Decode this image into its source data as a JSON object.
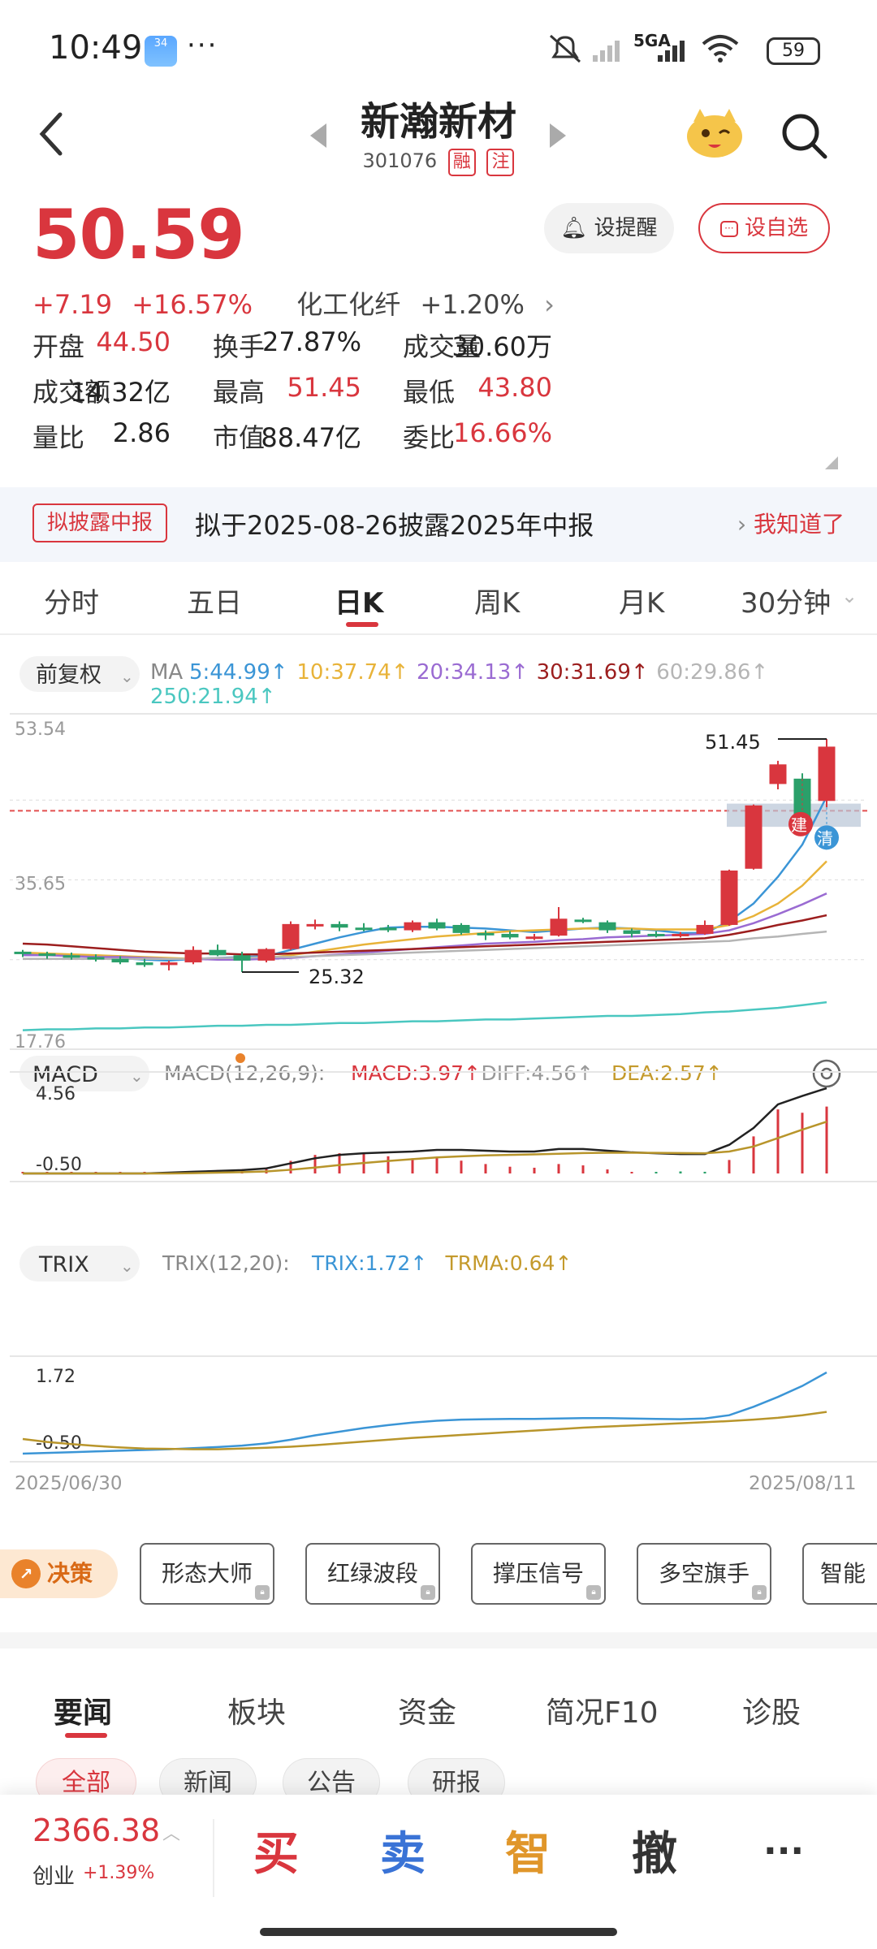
{
  "status_bar": {
    "time": "10:49",
    "weather_badge": "34",
    "network": "5GA",
    "battery": "59"
  },
  "header": {
    "stock_name": "新瀚新材",
    "stock_code": "301076",
    "tag_margin": "融",
    "tag_note": "注"
  },
  "quote": {
    "price": "50.59",
    "change": "+7.19",
    "change_pct": "+16.57%",
    "sector": "化工化纤",
    "sector_pct": "+1.20%",
    "alert_button": "设提醒",
    "fav_button": "设自选"
  },
  "stats": [
    {
      "label": "开盘",
      "value": "44.50",
      "color": "red"
    },
    {
      "label": "换手",
      "value": "27.87%",
      "color": "black"
    },
    {
      "label": "成交量",
      "value": "30.60万",
      "color": "black"
    },
    {
      "label": "成交额",
      "value": "14.32亿",
      "color": "black"
    },
    {
      "label": "最高",
      "value": "51.45",
      "color": "red"
    },
    {
      "label": "最低",
      "value": "43.80",
      "color": "red"
    },
    {
      "label": "量比",
      "value": "2.86",
      "color": "black"
    },
    {
      "label": "市值",
      "value": "88.47亿",
      "color": "black"
    },
    {
      "label": "委比",
      "value": "16.66%",
      "color": "red"
    }
  ],
  "banner": {
    "tag": "拟披露中报",
    "text": "拟于2025-08-26披露2025年中报",
    "ack": "我知道了"
  },
  "period_tabs": [
    "分时",
    "五日",
    "日K",
    "周K",
    "月K",
    "30分钟"
  ],
  "selected_tab": "日K",
  "chart_data": [
    {
      "type": "candlestick",
      "adjust": "前复权",
      "ma_legend": [
        {
          "label": "5:44.99",
          "color": "#3b95d6"
        },
        {
          "label": "10:37.74",
          "color": "#e8b339"
        },
        {
          "label": "20:34.13",
          "color": "#9a6bd2"
        },
        {
          "label": "30:31.69",
          "color": "#9c1e1e"
        },
        {
          "label": "60:29.86",
          "color": "#b5b5b5"
        },
        {
          "label": "250:21.94",
          "color": "#4ac7c0"
        }
      ],
      "y_ticks": [
        "53.54",
        "35.65",
        "17.76"
      ],
      "ylim": [
        17.76,
        53.54
      ],
      "high_label": "51.45",
      "low_label": "25.32",
      "markers": [
        "建",
        "清"
      ],
      "candles": [
        {
          "o": 27.6,
          "h": 27.8,
          "l": 27.0,
          "c": 27.4
        },
        {
          "o": 27.4,
          "h": 27.6,
          "l": 26.8,
          "c": 27.2
        },
        {
          "o": 27.2,
          "h": 27.5,
          "l": 26.7,
          "c": 27.0
        },
        {
          "o": 27.0,
          "h": 27.3,
          "l": 26.5,
          "c": 26.9
        },
        {
          "o": 26.8,
          "h": 27.1,
          "l": 26.2,
          "c": 26.4
        },
        {
          "o": 26.4,
          "h": 26.8,
          "l": 25.9,
          "c": 26.1
        },
        {
          "o": 26.1,
          "h": 26.6,
          "l": 25.5,
          "c": 26.4
        },
        {
          "o": 26.4,
          "h": 28.2,
          "l": 26.2,
          "c": 27.8
        },
        {
          "o": 27.8,
          "h": 28.4,
          "l": 27.1,
          "c": 27.2
        },
        {
          "o": 27.2,
          "h": 27.6,
          "l": 25.32,
          "c": 26.6
        },
        {
          "o": 26.6,
          "h": 28.0,
          "l": 26.4,
          "c": 27.9
        },
        {
          "o": 27.9,
          "h": 31.0,
          "l": 27.8,
          "c": 30.7
        },
        {
          "o": 30.6,
          "h": 31.2,
          "l": 30.1,
          "c": 30.7
        },
        {
          "o": 30.7,
          "h": 31.0,
          "l": 29.9,
          "c": 30.3
        },
        {
          "o": 30.3,
          "h": 30.8,
          "l": 29.9,
          "c": 30.2
        },
        {
          "o": 30.3,
          "h": 30.6,
          "l": 29.8,
          "c": 30.0
        },
        {
          "o": 30.0,
          "h": 31.1,
          "l": 29.8,
          "c": 30.9
        },
        {
          "o": 30.9,
          "h": 31.3,
          "l": 30.0,
          "c": 30.2
        },
        {
          "o": 30.6,
          "h": 30.8,
          "l": 29.5,
          "c": 29.7
        },
        {
          "o": 29.7,
          "h": 30.0,
          "l": 28.9,
          "c": 29.6
        },
        {
          "o": 29.6,
          "h": 29.9,
          "l": 29.0,
          "c": 29.2
        },
        {
          "o": 29.2,
          "h": 29.6,
          "l": 28.9,
          "c": 29.3
        },
        {
          "o": 29.4,
          "h": 32.6,
          "l": 29.3,
          "c": 31.3
        },
        {
          "o": 31.2,
          "h": 31.4,
          "l": 30.8,
          "c": 31.0
        },
        {
          "o": 30.9,
          "h": 31.1,
          "l": 29.7,
          "c": 30.0
        },
        {
          "o": 30.0,
          "h": 30.2,
          "l": 29.2,
          "c": 29.6
        },
        {
          "o": 29.6,
          "h": 29.9,
          "l": 29.2,
          "c": 29.4
        },
        {
          "o": 29.4,
          "h": 29.8,
          "l": 29.2,
          "c": 29.6
        },
        {
          "o": 29.6,
          "h": 31.1,
          "l": 29.5,
          "c": 30.6
        },
        {
          "o": 30.6,
          "h": 36.8,
          "l": 30.5,
          "c": 36.7
        },
        {
          "o": 36.9,
          "h": 44.1,
          "l": 36.8,
          "c": 44.0
        },
        {
          "o": 46.4,
          "h": 49.0,
          "l": 45.8,
          "c": 48.6
        },
        {
          "o": 47.0,
          "h": 47.6,
          "l": 41.4,
          "c": 41.8
        },
        {
          "o": 44.5,
          "h": 51.45,
          "l": 43.8,
          "c": 50.59
        }
      ],
      "ma_series": [
        {
          "name": "MA5",
          "color": "#3b95d6",
          "values": [
            27.4,
            27.3,
            27.2,
            27.1,
            26.9,
            26.7,
            26.6,
            26.8,
            26.9,
            27.0,
            27.1,
            27.8,
            28.5,
            29.2,
            29.8,
            30.3,
            30.4,
            30.4,
            30.3,
            30.2,
            30.0,
            29.8,
            30.0,
            30.2,
            30.3,
            30.2,
            30.0,
            29.7,
            29.7,
            31.0,
            33.0,
            36.0,
            39.6,
            44.99
          ]
        },
        {
          "name": "MA10",
          "color": "#e8b339",
          "values": [
            27.5,
            27.4,
            27.3,
            27.2,
            27.1,
            27.0,
            26.9,
            26.8,
            26.8,
            26.8,
            26.9,
            27.2,
            27.6,
            28.0,
            28.4,
            28.7,
            29.0,
            29.3,
            29.5,
            29.7,
            29.9,
            30.0,
            30.1,
            30.2,
            30.2,
            30.2,
            30.1,
            30.1,
            30.1,
            30.6,
            31.6,
            33.0,
            35.0,
            37.74
          ]
        },
        {
          "name": "MA20",
          "color": "#9a6bd2",
          "values": [
            27.2,
            27.2,
            27.1,
            27.0,
            27.0,
            26.9,
            26.8,
            26.8,
            26.7,
            26.7,
            26.8,
            26.9,
            27.1,
            27.3,
            27.5,
            27.7,
            27.9,
            28.1,
            28.3,
            28.5,
            28.6,
            28.7,
            28.9,
            29.0,
            29.2,
            29.3,
            29.4,
            29.5,
            29.6,
            30.0,
            30.8,
            31.8,
            32.9,
            34.13
          ]
        },
        {
          "name": "MA30",
          "color": "#9c1e1e",
          "values": [
            28.5,
            28.4,
            28.2,
            28.0,
            27.8,
            27.6,
            27.5,
            27.4,
            27.4,
            27.3,
            27.3,
            27.4,
            27.5,
            27.6,
            27.7,
            27.8,
            27.9,
            28.0,
            28.1,
            28.2,
            28.3,
            28.4,
            28.5,
            28.6,
            28.7,
            28.8,
            28.9,
            29.0,
            29.1,
            29.5,
            30.0,
            30.6,
            31.1,
            31.69
          ]
        },
        {
          "name": "MA60",
          "color": "#b5b5b5",
          "values": [
            26.8,
            26.8,
            26.8,
            26.8,
            26.8,
            26.8,
            26.8,
            26.8,
            26.9,
            26.9,
            27.0,
            27.0,
            27.1,
            27.2,
            27.3,
            27.4,
            27.5,
            27.6,
            27.7,
            27.8,
            27.9,
            28.0,
            28.1,
            28.2,
            28.3,
            28.4,
            28.5,
            28.6,
            28.7,
            28.8,
            29.1,
            29.3,
            29.6,
            29.86
          ]
        },
        {
          "name": "MA250",
          "color": "#4ac7c0",
          "values": [
            18.8,
            18.9,
            18.9,
            19.0,
            19.0,
            19.1,
            19.1,
            19.2,
            19.3,
            19.3,
            19.4,
            19.4,
            19.5,
            19.6,
            19.6,
            19.7,
            19.8,
            19.8,
            19.9,
            20.0,
            20.0,
            20.1,
            20.2,
            20.3,
            20.4,
            20.4,
            20.5,
            20.6,
            20.8,
            20.9,
            21.1,
            21.3,
            21.6,
            21.94
          ]
        }
      ],
      "x_labels": [
        "2025/06/30",
        "2025/08/11"
      ]
    },
    {
      "type": "line",
      "title": "MACD",
      "params": "MACD(12,26,9):",
      "legend": [
        {
          "label": "MACD:3.97",
          "color": "#d9363e"
        },
        {
          "label": "DIFF:4.56",
          "color": "#999"
        },
        {
          "label": "DEA:2.57",
          "color": "#c49a2c"
        }
      ],
      "y_ticks": [
        "4.56",
        "-0.50"
      ],
      "ylim": [
        -0.5,
        4.56
      ],
      "diff": [
        -0.5,
        -0.5,
        -0.5,
        -0.5,
        -0.5,
        -0.5,
        -0.45,
        -0.4,
        -0.35,
        -0.3,
        -0.2,
        0.1,
        0.4,
        0.6,
        0.7,
        0.75,
        0.8,
        0.9,
        0.9,
        0.85,
        0.8,
        0.8,
        0.95,
        0.95,
        0.85,
        0.75,
        0.7,
        0.65,
        0.65,
        1.2,
        2.2,
        3.6,
        4.1,
        4.56
      ],
      "dea": [
        -0.5,
        -0.5,
        -0.5,
        -0.5,
        -0.5,
        -0.5,
        -0.5,
        -0.48,
        -0.45,
        -0.42,
        -0.38,
        -0.28,
        -0.15,
        0.0,
        0.12,
        0.24,
        0.35,
        0.45,
        0.52,
        0.57,
        0.6,
        0.63,
        0.67,
        0.71,
        0.73,
        0.73,
        0.72,
        0.71,
        0.7,
        0.8,
        1.1,
        1.6,
        2.1,
        2.57
      ],
      "hist": [
        0,
        0,
        0,
        0,
        0,
        0,
        0.05,
        0.1,
        0.2,
        0.25,
        0.35,
        0.75,
        1.1,
        1.2,
        1.16,
        1.02,
        0.9,
        0.9,
        0.76,
        0.56,
        0.4,
        0.34,
        0.56,
        0.48,
        0.24,
        0.04,
        -0.04,
        -0.12,
        -0.1,
        0.8,
        2.2,
        3.8,
        3.6,
        3.97
      ]
    },
    {
      "type": "line",
      "title": "TRIX",
      "params": "TRIX(12,20):",
      "legend": [
        {
          "label": "TRIX:1.72",
          "color": "#3b95d6"
        },
        {
          "label": "TRMA:0.64",
          "color": "#c49a2c"
        }
      ],
      "y_ticks": [
        "1.72",
        "-0.50"
      ],
      "ylim": [
        -0.5,
        1.72
      ],
      "trix": [
        -0.5,
        -0.48,
        -0.46,
        -0.44,
        -0.42,
        -0.4,
        -0.38,
        -0.35,
        -0.32,
        -0.28,
        -0.22,
        -0.12,
        0.0,
        0.1,
        0.2,
        0.28,
        0.35,
        0.4,
        0.43,
        0.44,
        0.45,
        0.45,
        0.46,
        0.47,
        0.47,
        0.46,
        0.45,
        0.44,
        0.46,
        0.55,
        0.78,
        1.05,
        1.35,
        1.72
      ],
      "trma": [
        -0.1,
        -0.18,
        -0.24,
        -0.29,
        -0.33,
        -0.36,
        -0.37,
        -0.38,
        -0.38,
        -0.36,
        -0.34,
        -0.31,
        -0.27,
        -0.22,
        -0.17,
        -0.12,
        -0.07,
        -0.03,
        0.01,
        0.05,
        0.09,
        0.13,
        0.17,
        0.21,
        0.24,
        0.27,
        0.3,
        0.33,
        0.36,
        0.39,
        0.43,
        0.48,
        0.55,
        0.64
      ]
    }
  ],
  "tools": {
    "decision": "决策",
    "buttons": [
      "形态大师",
      "红绿波段",
      "撑压信号",
      "多空旗手",
      "智能"
    ]
  },
  "news_tabs": [
    "要闻",
    "板块",
    "资金",
    "简况F10",
    "诊股"
  ],
  "news_filters": [
    "全部",
    "新闻",
    "公告",
    "研报"
  ],
  "bottom": {
    "index_value": "2366.38",
    "index_name": "创业",
    "index_pct": "+1.39%",
    "buy": "买",
    "sell": "卖",
    "smart": "智",
    "cancel": "撤",
    "more": "···"
  }
}
